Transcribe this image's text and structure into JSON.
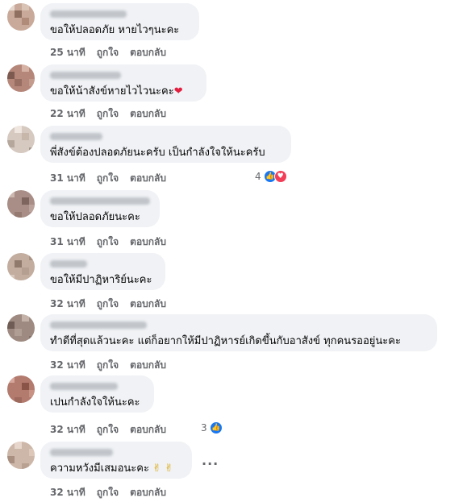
{
  "actions": {
    "like_label": "ถูกใจ",
    "reply_label": "ตอบกลับ"
  },
  "comments": [
    {
      "text": "ขอให้ปลอดภัย หายไวๆนะคะ",
      "time": "25 นาที"
    },
    {
      "text": "ขอให้น้าสังข์หายไวไวนะคะ",
      "emoji": "❤",
      "time": "22 นาที"
    },
    {
      "text": "พี่สังข์ต้องปลอดภัยนะครับ เป็นกำลังใจให้นะครับ",
      "time": "31 นาที",
      "reaction_count": "4",
      "reaction_types": [
        "like-icon",
        "love-icon"
      ]
    },
    {
      "text": "ขอให้ปลอดภัยนะคะ",
      "time": "31 นาที"
    },
    {
      "text": "ขอให้มีปาฏิหาริย์นะคะ",
      "time": "32 นาที"
    },
    {
      "text": "ทำดีที่สุดแล้วนะคะ แต่ก็อยากให้มีปาฏิหารย์เกิดขึ้นกับอาสังข์ ทุกคนรออยู่นะคะ",
      "time": "32 นาที"
    },
    {
      "text": "เปนกำลังใจให้นะคะ",
      "time": "32 นาที",
      "reaction_count": "3",
      "reaction_types": [
        "like-icon"
      ]
    },
    {
      "text": "ความหวังมีเสมอนะคะ",
      "emoji": "✌ ✌",
      "time": "32 นาที",
      "more": "..."
    }
  ],
  "colors": {
    "bubble": "#f0f2f5",
    "meta": "#65676b",
    "like": "#1877f2",
    "love": "#f33e58"
  }
}
